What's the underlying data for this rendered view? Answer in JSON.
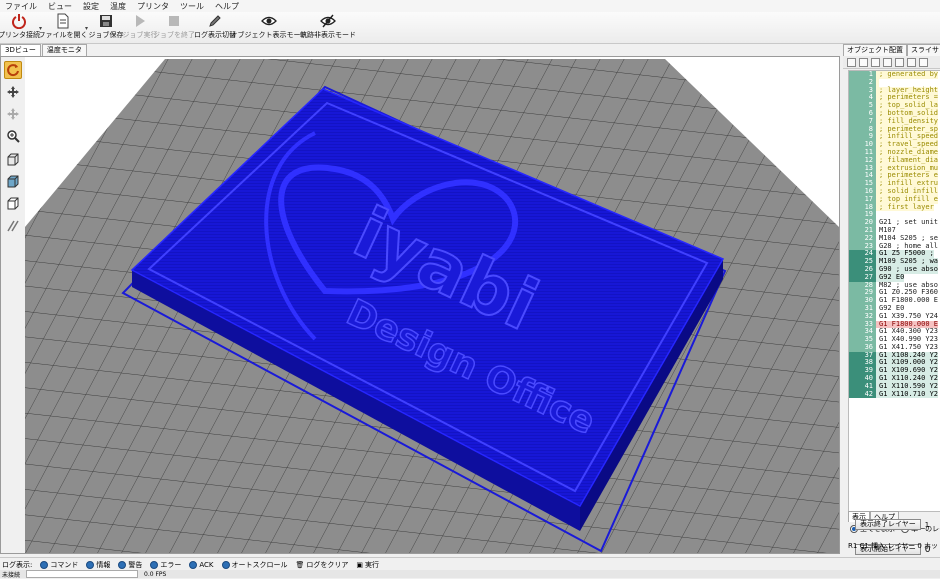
{
  "menu": [
    "ファイル",
    "ビュー",
    "設定",
    "温度",
    "プリンタ",
    "ツール",
    "ヘルプ"
  ],
  "toolbar": {
    "connect": "プリンタ接続",
    "load": "ファイルを開く",
    "save_job": "ジョブ保存",
    "run_job": "ジョブ実行",
    "stop_job": "ジョブを終了",
    "toggle_log": "ログ表示切替",
    "show_objects": "オブジェクト表示モード",
    "show_paths": "軌跡非表示モード"
  },
  "view_tabs": [
    "3Dビュー",
    "温度モニタ"
  ],
  "right_tabs": [
    "オブジェクト配置",
    "スライサ",
    "Gコ"
  ],
  "gcode_lines": [
    {
      "n": "1",
      "t": "; generated by",
      "k": "c"
    },
    {
      "n": "2",
      "t": "",
      "k": "c"
    },
    {
      "n": "3",
      "t": "; layer_height",
      "k": "c"
    },
    {
      "n": "4",
      "t": "; perimeters =",
      "k": "c"
    },
    {
      "n": "5",
      "t": "; top_solid_la",
      "k": "c"
    },
    {
      "n": "6",
      "t": "; bottom_solid",
      "k": "c"
    },
    {
      "n": "7",
      "t": "; fill_density",
      "k": "c"
    },
    {
      "n": "8",
      "t": "; perimeter_sp",
      "k": "c"
    },
    {
      "n": "9",
      "t": "; infill_speed",
      "k": "c"
    },
    {
      "n": "10",
      "t": "; travel_speed",
      "k": "c"
    },
    {
      "n": "11",
      "t": "; nozzle_diame",
      "k": "c"
    },
    {
      "n": "12",
      "t": "; filament_dia",
      "k": "c"
    },
    {
      "n": "13",
      "t": "; extrusion_mu",
      "k": "c"
    },
    {
      "n": "14",
      "t": "; perimeters e",
      "k": "c"
    },
    {
      "n": "15",
      "t": "; infill extru",
      "k": "c"
    },
    {
      "n": "16",
      "t": "; solid infill",
      "k": "c"
    },
    {
      "n": "17",
      "t": "; top infill e",
      "k": "c"
    },
    {
      "n": "18",
      "t": "; first layer",
      "k": "c"
    },
    {
      "n": "19",
      "t": "",
      "k": "g"
    },
    {
      "n": "20",
      "t": "G21 ; set unit",
      "k": "g"
    },
    {
      "n": "21",
      "t": "M107",
      "k": "g"
    },
    {
      "n": "22",
      "t": "M104 S205 ; se",
      "k": "g"
    },
    {
      "n": "23",
      "t": "G28 ; home all",
      "k": "g"
    },
    {
      "n": "24",
      "t": "G1 Z5 F5000 ;",
      "k": "hl"
    },
    {
      "n": "25",
      "t": "M109 S205 ; wa",
      "k": "hl"
    },
    {
      "n": "26",
      "t": "G90 ; use abso",
      "k": "hl"
    },
    {
      "n": "27",
      "t": "G92 E0",
      "k": "hl"
    },
    {
      "n": "28",
      "t": "M82 ; use abso",
      "k": "g"
    },
    {
      "n": "29",
      "t": "G1 Z0.250 F360",
      "k": "g"
    },
    {
      "n": "30",
      "t": "G1 F1800.000 E",
      "k": "g"
    },
    {
      "n": "31",
      "t": "G92 E0",
      "k": "g"
    },
    {
      "n": "32",
      "t": "G1 X39.750 Y24",
      "k": "g"
    },
    {
      "n": "33",
      "t": "G1 F1800.000 E",
      "k": "sel"
    },
    {
      "n": "34",
      "t": "G1 X40.300 Y23",
      "k": "g"
    },
    {
      "n": "35",
      "t": "G1 X40.990 Y23",
      "k": "g"
    },
    {
      "n": "36",
      "t": "G1 X41.750 Y23",
      "k": "g"
    },
    {
      "n": "37",
      "t": "G1 X108.240 Y2",
      "k": "hl"
    },
    {
      "n": "38",
      "t": "G1 X109.000 Y2",
      "k": "hl"
    },
    {
      "n": "39",
      "t": "G1 X109.690 Y2",
      "k": "hl"
    },
    {
      "n": "40",
      "t": "G1 X110.240 Y2",
      "k": "hl"
    },
    {
      "n": "41",
      "t": "G1 X110.590 Y2",
      "k": "hl"
    },
    {
      "n": "42",
      "t": "G1 X110.710 Y2",
      "k": "hl"
    }
  ],
  "view_panel": {
    "tabs": [
      "表示",
      "ヘルプ"
    ],
    "show_all": "全てを表示",
    "single_layer": "単一のレイ",
    "start_layer_btn": "表示開始レイヤー",
    "start_layer_val": "0",
    "end_layer_btn": "表示終了レイヤー",
    "end_layer_val": "1"
  },
  "editor_status": "R1 C1 挿入 レイヤー 0 ホットエ",
  "logbar": {
    "label": "ログ表示:",
    "options": [
      "コマンド",
      "情報",
      "警告",
      "エラー",
      "ACK",
      "オートスクロール"
    ],
    "clear": "ログをクリア",
    "run": "実行"
  },
  "status": {
    "left": "未接続",
    "mid": "0.0 FPS"
  },
  "model": {
    "text_line1": "iyabi",
    "text_line2": "Design Office"
  },
  "colors": {
    "bed": "#8a8a8a",
    "model": "#1616d8",
    "accent": "#f2c14e",
    "gcode_gutter": "#7bbaa3"
  },
  "icons": {
    "active_tool": "rotate-icon"
  }
}
